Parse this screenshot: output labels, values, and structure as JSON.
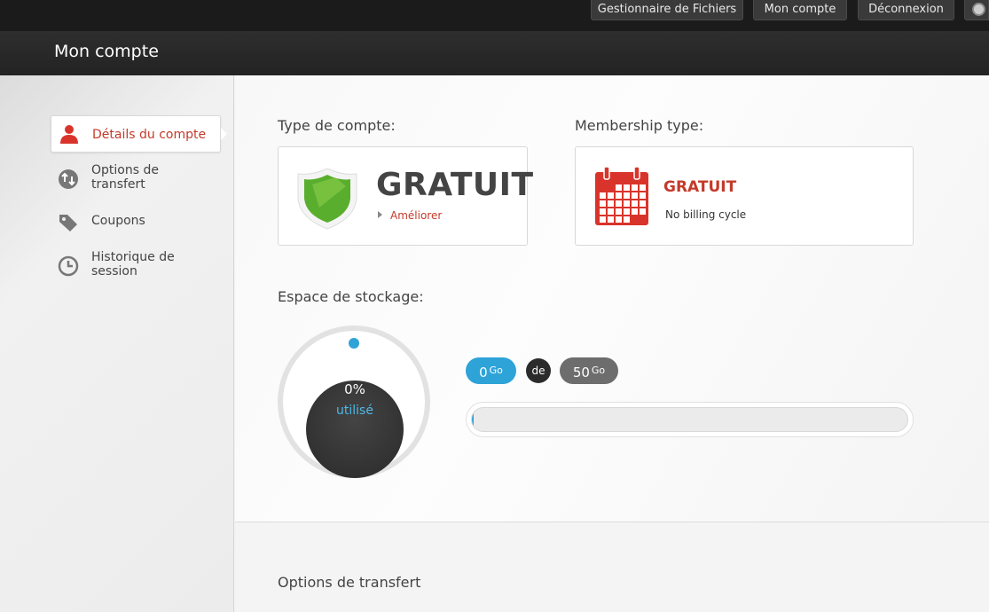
{
  "topnav": {
    "file_manager": "Gestionnaire de Fichiers",
    "my_account": "Mon compte",
    "logout": "Déconnexion",
    "language_icon": "globe-icon"
  },
  "header": {
    "title": "Mon compte"
  },
  "sidebar": {
    "items": [
      {
        "label": "Détails du compte",
        "icon": "user-icon",
        "active": true
      },
      {
        "label": "Options de\ntransfert",
        "icon": "transfer-icon",
        "active": false
      },
      {
        "label": "Coupons",
        "icon": "tag-icon",
        "active": false
      },
      {
        "label": "Historique de\nsession",
        "icon": "clock-icon",
        "active": false
      }
    ]
  },
  "account_type": {
    "label": "Type de compte:",
    "value": "GRATUIT",
    "upgrade_link": "Améliorer",
    "icon": "shield-icon"
  },
  "membership": {
    "label": "Membership type:",
    "value": "GRATUIT",
    "billing": "No billing cycle",
    "icon": "calendar-icon"
  },
  "storage": {
    "label": "Espace de stockage:",
    "percent_text": "0%",
    "used_label": "utilisé",
    "used_value": "0",
    "used_unit": "Go",
    "of_label": "de",
    "total_value": "50",
    "total_unit": "Go",
    "used_fraction": 0.0,
    "accent_color": "#2ea3d8"
  },
  "transfer_section": {
    "label": "Options de transfert"
  }
}
